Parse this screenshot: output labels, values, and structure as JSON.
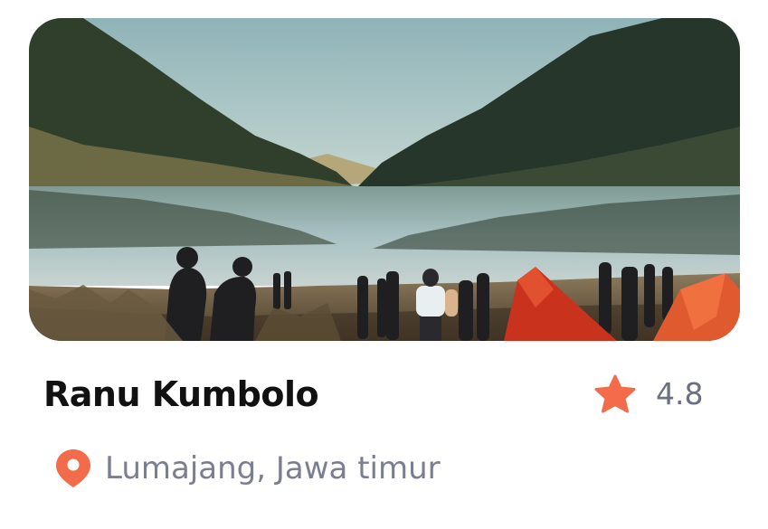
{
  "card": {
    "image_icon": "lake-landscape-photo",
    "title": "Ranu Kumbolo",
    "rating": "4.8",
    "rating_icon": "star-icon",
    "location": "Lumajang, Jawa timur",
    "location_icon": "map-pin-icon",
    "accent_color": "#f26b4a"
  }
}
